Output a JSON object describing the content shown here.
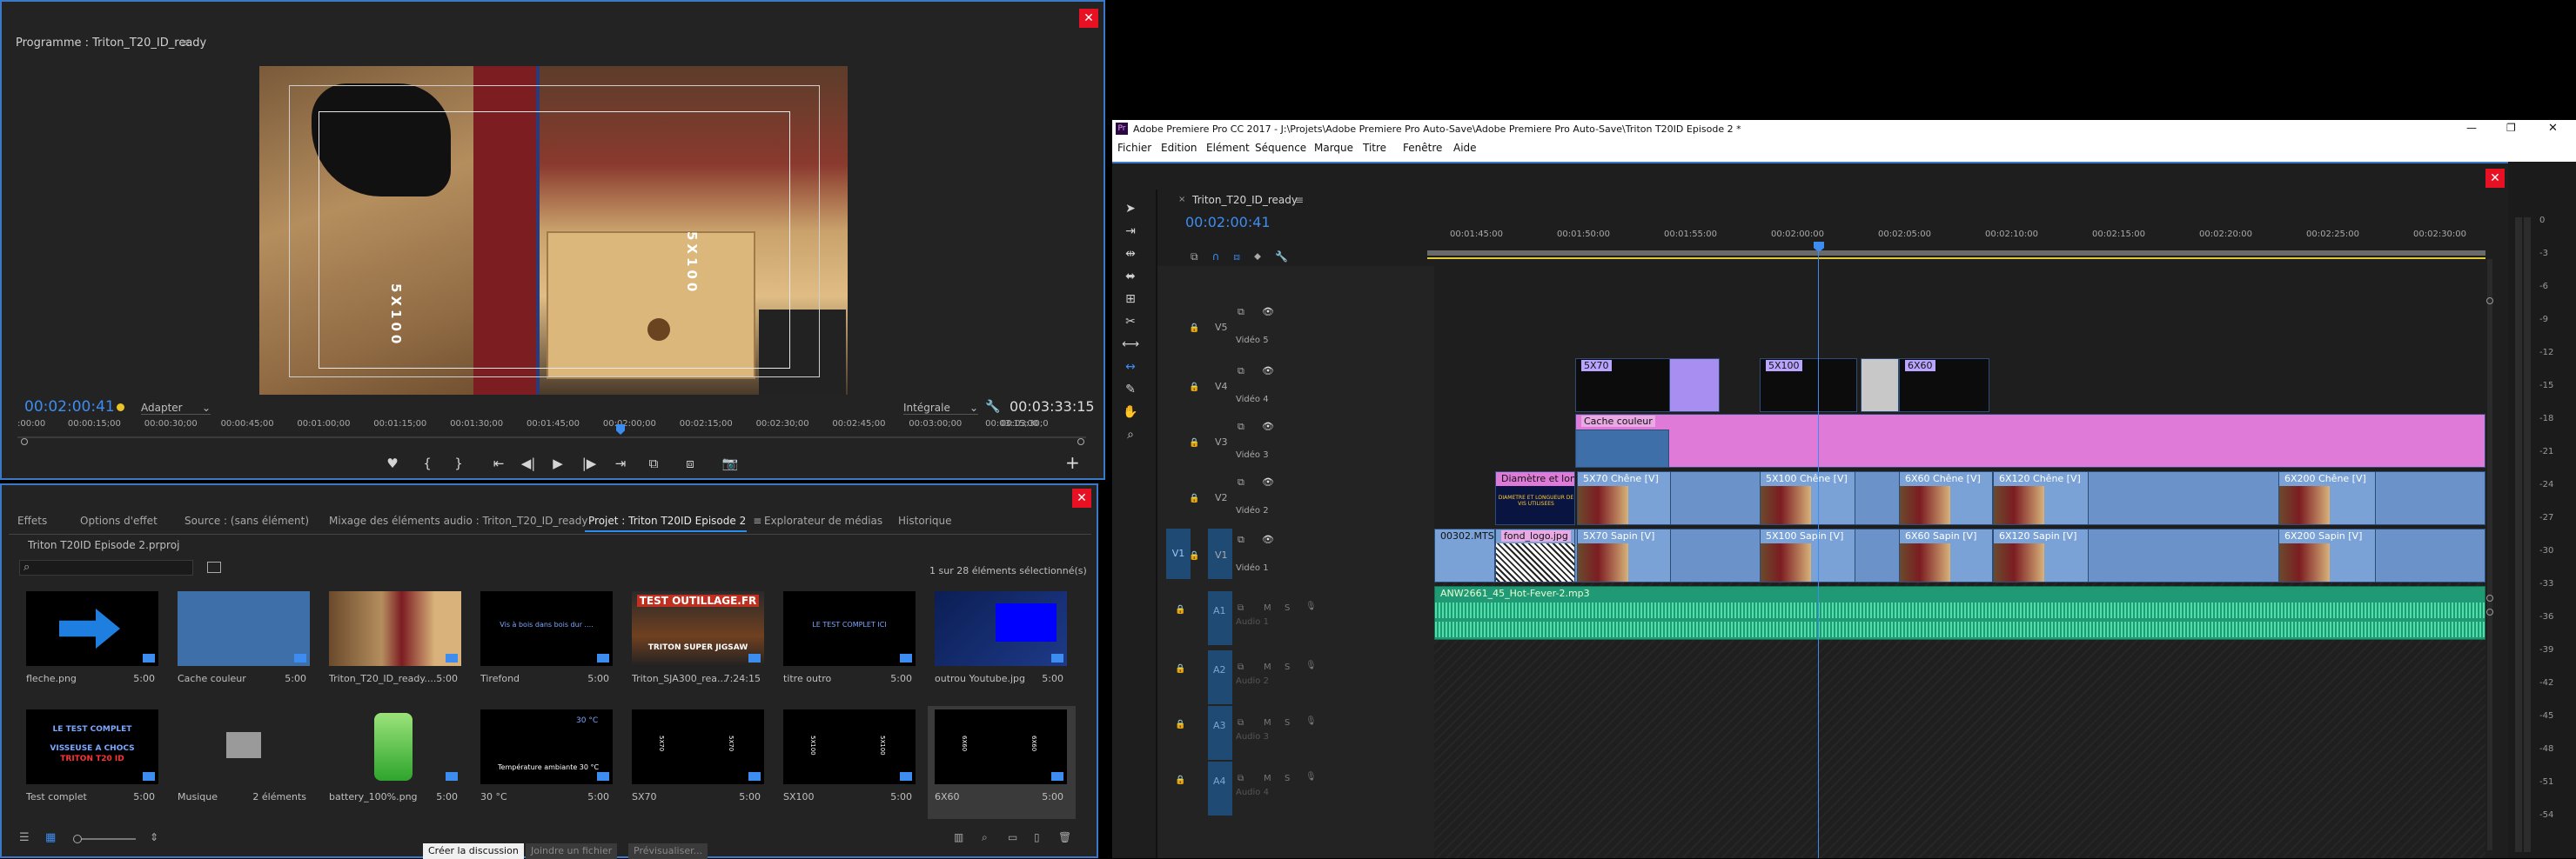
{
  "program_monitor": {
    "title": "Programme : Triton_T20_ID_ready",
    "menu_glyph": "≡",
    "current_tc": "00:02:00:41",
    "fit_label": "Adapter",
    "quality_label": "Intégrale",
    "duration_tc": "00:03:33:15",
    "overlay_text_left": "5X100",
    "overlay_text_right": "5X100",
    "ruler_labels": [
      ":00:00",
      "00:00:15;00",
      "00:00:30;00",
      "00:00:45;00",
      "00:01:00;00",
      "00:01:15;00",
      "00:01:30;00",
      "00:01:45;00",
      "00:02:00;00",
      "00:02:15;00",
      "00:02:30;00",
      "00:02:45;00",
      "00:03:00;00",
      "00:03:15;00",
      "00:03:30;0"
    ],
    "controls": [
      "♥",
      "{",
      "}",
      "⇤",
      "◀|",
      "▶",
      "|▶",
      "⇥",
      "⧉",
      "⧈",
      "📷"
    ],
    "add_glyph": "+"
  },
  "project_panel": {
    "tabs": [
      "Effets",
      "Options d'effet",
      "Source : (sans élément)",
      "Mixage des éléments audio : Triton_T20_ID_ready",
      "Projet : Triton T20ID Episode 2",
      "Explorateur de médias",
      "Historique"
    ],
    "active_tab_index": 4,
    "project_file": "Triton T20ID Episode 2.prproj",
    "search_icon": "⌕",
    "selection_count": "1 sur 28 éléments sélectionné(s)",
    "items": [
      {
        "name": "fleche.png",
        "dur": "5:00",
        "kind": "arrow"
      },
      {
        "name": "Cache couleur",
        "dur": "5:00",
        "kind": "color"
      },
      {
        "name": "Triton_T20_ID_ready....",
        "dur": "5:00",
        "kind": "photo"
      },
      {
        "name": "Tirefond",
        "dur": "5:00",
        "kind": "dark-text",
        "caption": "Vis à bois dans bois dur ...."
      },
      {
        "name": "Triton_SJA300_rea...",
        "dur": "7:24:15",
        "kind": "poster",
        "caption": "TEST OUTILLAGE.FR",
        "caption2": "TRITON SUPER JIGSAW"
      },
      {
        "name": "titre outro",
        "dur": "5:00",
        "kind": "dark-text",
        "caption": "LE TEST COMPLET ICI"
      },
      {
        "name": "outrou Youtube.jpg",
        "dur": "5:00",
        "kind": "youtube"
      },
      {
        "name": "Test complet",
        "dur": "5:00",
        "kind": "testcomplet",
        "caption": "LE TEST COMPLET",
        "caption2": "VISSEUSE A CHOCS",
        "caption3": "TRITON T20 ID"
      },
      {
        "name": "Musique",
        "dur": "2 éléments",
        "kind": "folder"
      },
      {
        "name": "battery_100%.png",
        "dur": "5:00",
        "kind": "battery"
      },
      {
        "name": "30 °C",
        "dur": "5:00",
        "kind": "temp",
        "caption": "30 °C",
        "caption2": "Température ambiante  30 °C"
      },
      {
        "name": "SX70",
        "dur": "5:00",
        "kind": "sx",
        "caption": "5X70"
      },
      {
        "name": "SX100",
        "dur": "5:00",
        "kind": "sx",
        "caption": "5X100"
      },
      {
        "name": "6X60",
        "dur": "5:00",
        "kind": "sx-sel",
        "caption": "6X60"
      }
    ],
    "bottom_tabs": [
      "Créer la discussion",
      "Joindre un fichier",
      "Prévisualiser..."
    ]
  },
  "app": {
    "title": "Adobe Premiere Pro CC 2017 - J:\\Projets\\Adobe Premiere Pro Auto-Save\\Adobe Premiere Pro Auto-Save\\Triton T20ID Episode 2 *",
    "menu": [
      "Fichier",
      "Edition",
      "Elément",
      "Séquence",
      "Marque",
      "Titre",
      "Fenêtre",
      "Aide"
    ],
    "minimize": "—",
    "maximize": "❐",
    "close": "✕"
  },
  "timeline": {
    "tab_title": "Triton_T20_ID_ready",
    "tc": "00:02:00:41",
    "ruler_labels": [
      "00:01:45:00",
      "00:01:50:00",
      "00:01:55:00",
      "00:02:00:00",
      "00:02:05:00",
      "00:02:10:00",
      "00:02:15:00",
      "00:02:20:00",
      "00:02:25:00",
      "00:02:30:00"
    ],
    "video_tracks": [
      {
        "id": "V5",
        "name": "Vidéo 5"
      },
      {
        "id": "V4",
        "name": "Vidéo 4"
      },
      {
        "id": "V3",
        "name": "Vidéo 3"
      },
      {
        "id": "V2",
        "name": "Vidéo 2"
      },
      {
        "id": "V1",
        "name": "Vidéo 1",
        "src": "V1"
      }
    ],
    "audio_tracks": [
      {
        "id": "A1",
        "name": "Audio 1"
      },
      {
        "id": "A2",
        "name": "Audio 2"
      },
      {
        "id": "A3",
        "name": "Audio 3"
      },
      {
        "id": "A4",
        "name": "Audio 4"
      }
    ],
    "clips_v4": [
      "5X70",
      "5X100",
      "6X60"
    ],
    "clip_v3": "Cache couleur",
    "clips_v2": [
      "Diamètre et longue",
      "5X70 Chêne [V]",
      "5X100 Chêne [V]",
      "6X60 Chêne [V]",
      "6X120 Chêne [V]",
      "6X200 Chêne [V]"
    ],
    "v2_text": "DIAMETRE ET LONGUEUR DE VIS UTILISEES",
    "clips_v1": [
      "00302.MTS",
      "fond_logo.jpg",
      "5X70 Sapin [V]",
      "5X100 Sapin [V]",
      "6X60 Sapin [V]",
      "6X120 Sapin [V]",
      "6X200 Sapin [V]"
    ],
    "audio_clip": "ANW2661_45_Hot-Fever-2.mp3",
    "track_btns": {
      "m": "M",
      "s": "S",
      "lock": "🔒",
      "eye": "👁",
      "mic": "🎙"
    }
  },
  "meter_labels": [
    "0",
    "-3",
    "-6",
    "-9",
    "-12",
    "-15",
    "-18",
    "-21",
    "-24",
    "-27",
    "-30",
    "-33",
    "-36",
    "-39",
    "-42",
    "-45",
    "-48",
    "-51",
    "-54"
  ]
}
